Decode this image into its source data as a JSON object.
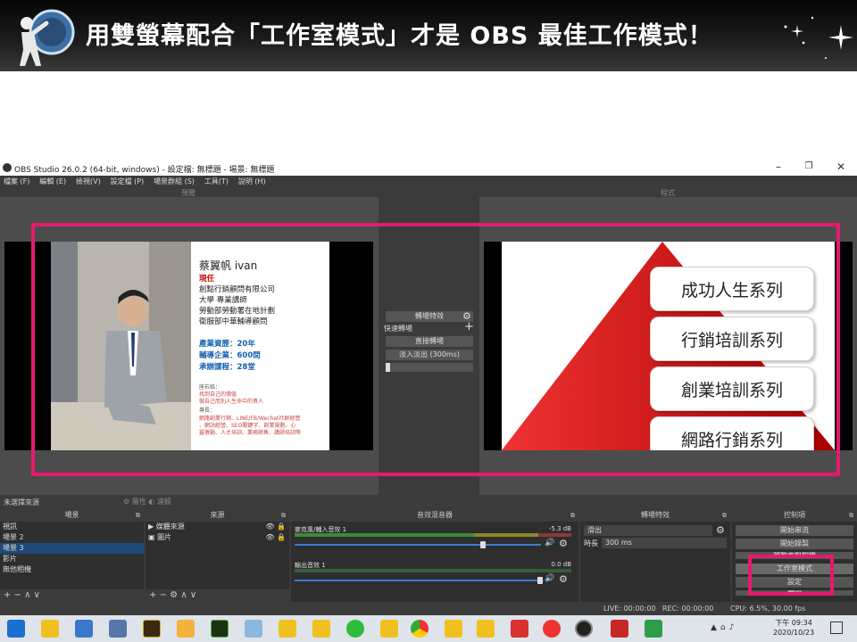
{
  "banner": {
    "title": "用雙螢幕配合「工作室模式」才是 OBS 最佳工作模式！"
  },
  "window": {
    "title": "OBS Studio 26.0.2 (64-bit, windows) - 設定檔: 無標題 - 場景: 無標題"
  },
  "menu": [
    "檔案 (F)",
    "編輯 (E)",
    "檢視(V)",
    "設定檔 (P)",
    "場景群組 (S)",
    "工具(T)",
    "說明 (H)"
  ],
  "panes": {
    "preview": "預覽",
    "program": "程式"
  },
  "card": {
    "name": "蔡翼帆 ivan",
    "current_label": "現任",
    "roles": [
      "創點行銷顧問有限公司",
      "大學 專業講師",
      "勞動部勞動署在地計劃",
      "衛服部中華輔導顧問"
    ],
    "stats": [
      "產業資歷：20年",
      "輔導企業：600間",
      "承辦課程：28堂"
    ],
    "notes": [
      "座右銘：",
      "找到自己的價值",
      "做自己而別人生命中的貴人",
      "專長：",
      "網路創業行銷、LINE/FB/Wechat社群經營",
      "、網站經營、SEO關鍵字、創業規劃、心",
      "靈激勵、人才培訓、業務銷售、講師培訓等"
    ]
  },
  "slide": {
    "items": [
      "成功人生系列",
      "行銷培訓系列",
      "創業培訓系列",
      "網路行銷系列"
    ]
  },
  "transition_mid": {
    "button": "轉場特效",
    "quick": "快速轉場",
    "cut": "直接轉場",
    "fade": "淡入淡出 (300ms)"
  },
  "status": {
    "no_source": "未選擇來源",
    "props": "屬性",
    "filters": "濾鏡"
  },
  "docks": {
    "scenes": {
      "title": "場景",
      "items": [
        "視訊",
        "場景 2",
        "場景 3",
        "影片",
        "無他相機"
      ],
      "selected": 2
    },
    "sources": {
      "title": "來源",
      "items": [
        "媒體來源",
        "圖片"
      ]
    },
    "mixer": {
      "title": "音效混音器",
      "ch1": "麥克風/輔入音效 1",
      "ch1_db": "-5.3 dB",
      "ch2": "輸出音效 1",
      "ch2_db": "0.0 dB"
    },
    "transitions": {
      "title": "轉場特效",
      "selected": "滑出",
      "duration_label": "時長",
      "duration": "300 ms"
    },
    "controls": {
      "title": "控制項",
      "buttons": [
        "開始串流",
        "開始錄製",
        "啟動虛擬相機",
        "工作室模式",
        "設定",
        "離開"
      ]
    }
  },
  "stats": {
    "live": "LIVE: 00:00:00",
    "rec": "REC: 00:00:00",
    "cpu": "CPU: 6.5%, 30.00 fps"
  },
  "clock": {
    "time": "下午 09:34",
    "date": "2020/10/23"
  }
}
